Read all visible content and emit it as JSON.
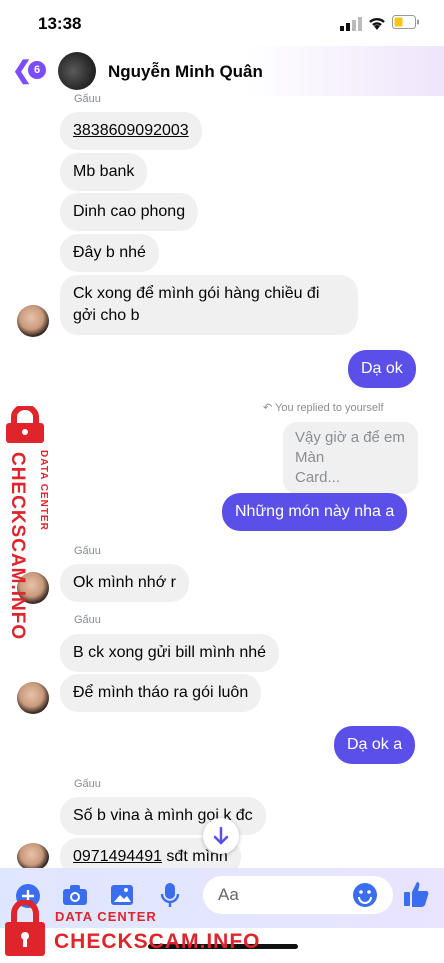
{
  "status": {
    "time": "13:38"
  },
  "header": {
    "back_count": "6",
    "name": "Nguyễn Minh Quân"
  },
  "messages": {
    "sender1": "Gấuu",
    "m1": "3838609092003",
    "m2": "Mb bank",
    "m3": "Dinh cao phong",
    "m4": "Đây b nhé",
    "m5a": "Ck xong để mình gói hàng chiều đi",
    "m5b": "gởi cho b",
    "out1": "Dạ ok",
    "replied_note": "You replied to yourself",
    "reply_preview_a": "Vậy giờ a để em",
    "reply_preview_b": "Màn",
    "reply_preview_c": "Card...",
    "out2": "Những món này nha a",
    "sender2": "Gấuu",
    "m6": "Ok mình nhớ r",
    "sender3": "Gấuu",
    "m7": "B ck xong gửi bill mình nhé",
    "m8": "Để mình tháo ra gói luôn",
    "out3": "Dạ ok a",
    "sender4": "Gấuu",
    "m9": "Số b vina à mình gọi k đc",
    "m10_num": "0971494491",
    "m10_rest": " sđt mình"
  },
  "composer": {
    "placeholder": "Aa"
  },
  "watermark": {
    "side_label": "DATA CENTER",
    "side_site": "CHECKSCAM.INFO",
    "bottom_label": "DATA CENTER",
    "bottom_site": "CHECKSCAM.INFO"
  },
  "colors": {
    "accent": "#7b4dff",
    "outgoing": "#5b4fe9",
    "watermark": "#e0242b"
  }
}
